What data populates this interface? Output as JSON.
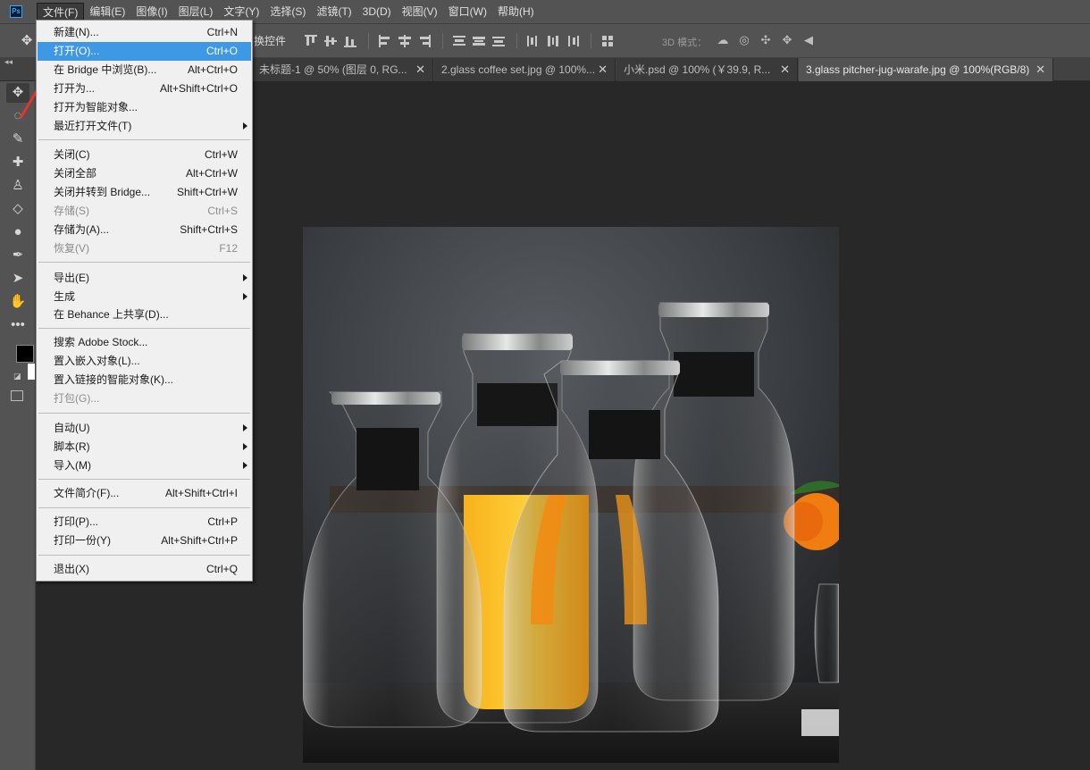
{
  "menubar": {
    "logo": "Ps",
    "items": [
      "文件(F)",
      "编辑(E)",
      "图像(I)",
      "图层(L)",
      "文字(Y)",
      "选择(S)",
      "滤镜(T)",
      "3D(D)",
      "视图(V)",
      "窗口(W)",
      "帮助(H)"
    ]
  },
  "options": {
    "show_controls_label": "换控件",
    "mode3d_label": "3D 模式："
  },
  "tabs": [
    {
      "label": "未标题-1 @ 50% (图层 0, RG..."
    },
    {
      "label": "2.glass coffee set.jpg @ 100%..."
    },
    {
      "label": "小米.psd @ 100% (￥39.9, R..."
    },
    {
      "label": "3.glass pitcher-jug-warafe.jpg @ 100%(RGB/8)"
    }
  ],
  "file_menu": {
    "new": {
      "label": "新建(N)...",
      "shortcut": "Ctrl+N"
    },
    "open": {
      "label": "打开(O)...",
      "shortcut": "Ctrl+O"
    },
    "browse_bridge": {
      "label": "在 Bridge 中浏览(B)...",
      "shortcut": "Alt+Ctrl+O"
    },
    "open_as": {
      "label": "打开为...",
      "shortcut": "Alt+Shift+Ctrl+O"
    },
    "open_smart": {
      "label": "打开为智能对象..."
    },
    "recent": {
      "label": "最近打开文件(T)"
    },
    "close": {
      "label": "关闭(C)",
      "shortcut": "Ctrl+W"
    },
    "close_all": {
      "label": "关闭全部",
      "shortcut": "Alt+Ctrl+W"
    },
    "close_bridge": {
      "label": "关闭并转到 Bridge...",
      "shortcut": "Shift+Ctrl+W"
    },
    "save": {
      "label": "存储(S)",
      "shortcut": "Ctrl+S"
    },
    "save_as": {
      "label": "存储为(A)...",
      "shortcut": "Shift+Ctrl+S"
    },
    "revert": {
      "label": "恢复(V)",
      "shortcut": "F12"
    },
    "export": {
      "label": "导出(E)"
    },
    "generate": {
      "label": "生成"
    },
    "behance": {
      "label": "在 Behance 上共享(D)..."
    },
    "adobe_stock": {
      "label": "搜索 Adobe Stock..."
    },
    "place_embed": {
      "label": "置入嵌入对象(L)..."
    },
    "place_linked": {
      "label": "置入链接的智能对象(K)..."
    },
    "package": {
      "label": "打包(G)..."
    },
    "automate": {
      "label": "自动(U)"
    },
    "scripts": {
      "label": "脚本(R)"
    },
    "import": {
      "label": "导入(M)"
    },
    "file_info": {
      "label": "文件简介(F)...",
      "shortcut": "Alt+Shift+Ctrl+I"
    },
    "print": {
      "label": "打印(P)...",
      "shortcut": "Ctrl+P"
    },
    "print_one": {
      "label": "打印一份(Y)",
      "shortcut": "Alt+Shift+Ctrl+P"
    },
    "exit": {
      "label": "退出(X)",
      "shortcut": "Ctrl+Q"
    }
  },
  "colors": {
    "highlight": "#3f98e6",
    "annotation_arrow": "#e8322c"
  }
}
